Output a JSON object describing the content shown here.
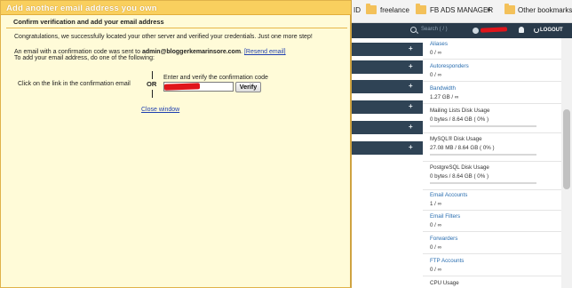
{
  "browser": {
    "bookmarks": {
      "partial_item": "ID",
      "freelance": "freelance",
      "fb_ads_manager": "FB ADS MANAGER",
      "overflow": "»",
      "other_bookmarks": "Other bookmarks"
    }
  },
  "cpanel": {
    "header": {
      "search_placeholder": "Search ( / )",
      "logout_label": "LOGOUT"
    },
    "section_bar_icon": "+",
    "stats": [
      {
        "label": "Aliases",
        "value": "0 / ∞",
        "has_bar": false
      },
      {
        "label": "Autoresponders",
        "value": "0 / ∞",
        "has_bar": false
      },
      {
        "label": "Bandwidth",
        "value": "1.27 GB / ∞",
        "has_bar": false
      },
      {
        "label": "Mailing Lists Disk Usage",
        "value": "0 bytes / 8.64 GB ( 0% )",
        "has_bar": true
      },
      {
        "label": "MySQL® Disk Usage",
        "value": "27.08 MB / 8.64 GB ( 0% )",
        "has_bar": true
      },
      {
        "label": "PostgreSQL Disk Usage",
        "value": "0 bytes / 8.64 GB ( 0% )",
        "has_bar": true
      },
      {
        "label": "Email Accounts",
        "value": "1 / ∞",
        "has_bar": false
      },
      {
        "label": "Email Filters",
        "value": "0 / ∞",
        "has_bar": false
      },
      {
        "label": "Forwarders",
        "value": "0 / ∞",
        "has_bar": false
      },
      {
        "label": "FTP Accounts",
        "value": "0 / ∞",
        "has_bar": false
      },
      {
        "label": "CPU Usage",
        "value": "",
        "has_bar": false
      }
    ]
  },
  "dialog": {
    "title": "Add another email address you own",
    "subhead": "Confirm verification and add your email address",
    "congrats": "Congratulations, we successfully located your other server and verified your credentials. Just one more step!",
    "sent_prefix": "An email with a confirmation code was sent to ",
    "email": "admin@bloggerkemarinsore.com",
    "sent_suffix": ". ",
    "resend_link": "[Resend email]",
    "todo": "To add your email address, do one of the following:",
    "click_link": "Click on the link in the confirmation email",
    "or": "OR",
    "enter_verify": "Enter and verify the confirmation code",
    "verify_button": "Verify",
    "close_window": "Close window"
  }
}
